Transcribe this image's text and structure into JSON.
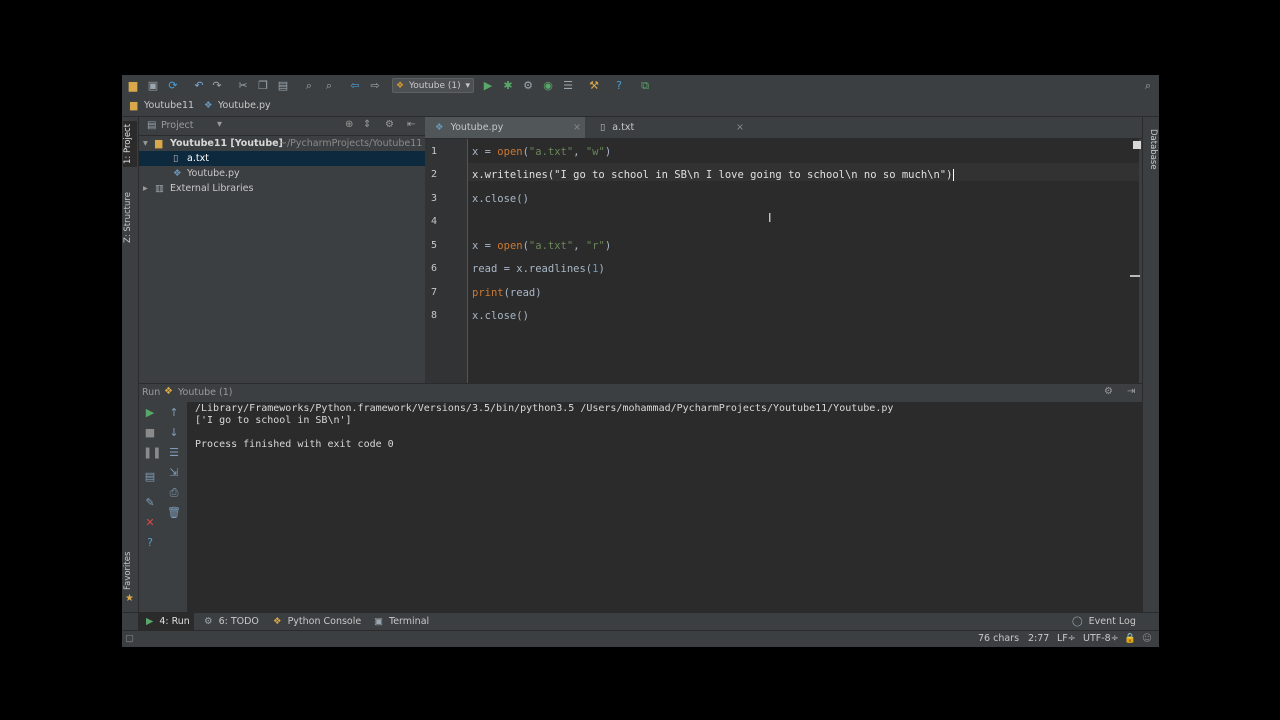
{
  "toolbar": {
    "run_config": "Youtube (1)"
  },
  "breadcrumb": {
    "project": "Youtube11",
    "file": "Youtube.py"
  },
  "left_strip": {
    "project_tab": "1: Project",
    "structure_tab": "Z: Structure",
    "favorites_tab": "Favorites"
  },
  "right_strip": {
    "database_tab": "Database"
  },
  "project_panel": {
    "title": "Project",
    "root": "Youtube11 [Youtube]",
    "root_path": "~/PycharmProjects/Youtube11",
    "files": [
      "a.txt",
      "Youtube.py"
    ],
    "external": "External Libraries"
  },
  "editor": {
    "tabs": [
      "Youtube.py",
      "a.txt"
    ],
    "line_numbers": [
      "1",
      "2",
      "3",
      "4",
      "5",
      "6",
      "7",
      "8"
    ],
    "lines": {
      "l1": {
        "var": "x",
        "op": " = ",
        "fn": "open",
        "p1": "(",
        "s1": "\"a.txt\"",
        "c": ", ",
        "s2": "\"w\"",
        "p2": ")"
      },
      "l2": "x.writelines(\"I go to school in SB\\n I love going to school\\n no so much\\n\")",
      "l3": "x.close()",
      "l5": {
        "var": "x",
        "op": " = ",
        "fn": "open",
        "p1": "(",
        "s1": "\"a.txt\"",
        "c": ", ",
        "s2": "\"r\"",
        "p2": ")"
      },
      "l6": {
        "a": "read",
        "b": " = ",
        "c": "x.readlines(",
        "num": "1",
        "d": ")"
      },
      "l7": {
        "fn": "print",
        "rest": "(read)"
      },
      "l8": "x.close()"
    }
  },
  "run_panel": {
    "label": "Run",
    "config": "Youtube (1)",
    "console": [
      "/Library/Frameworks/Python.framework/Versions/3.5/bin/python3.5 /Users/mohammad/PycharmProjects/Youtube11/Youtube.py",
      "['I go to school in SB\\n']",
      "",
      "Process finished with exit code 0"
    ]
  },
  "bottom_tabs": {
    "run": "4: Run",
    "todo": "6: TODO",
    "python_console": "Python Console",
    "terminal": "Terminal",
    "event_log": "Event Log"
  },
  "status": {
    "chars": "76 chars",
    "position": "2:77",
    "line_sep": "LF÷",
    "encoding": "UTF-8÷"
  },
  "colors": {
    "keyword": "#cc7832",
    "string": "#6a8759",
    "number": "#6897bb",
    "text": "#a9b7c6"
  }
}
